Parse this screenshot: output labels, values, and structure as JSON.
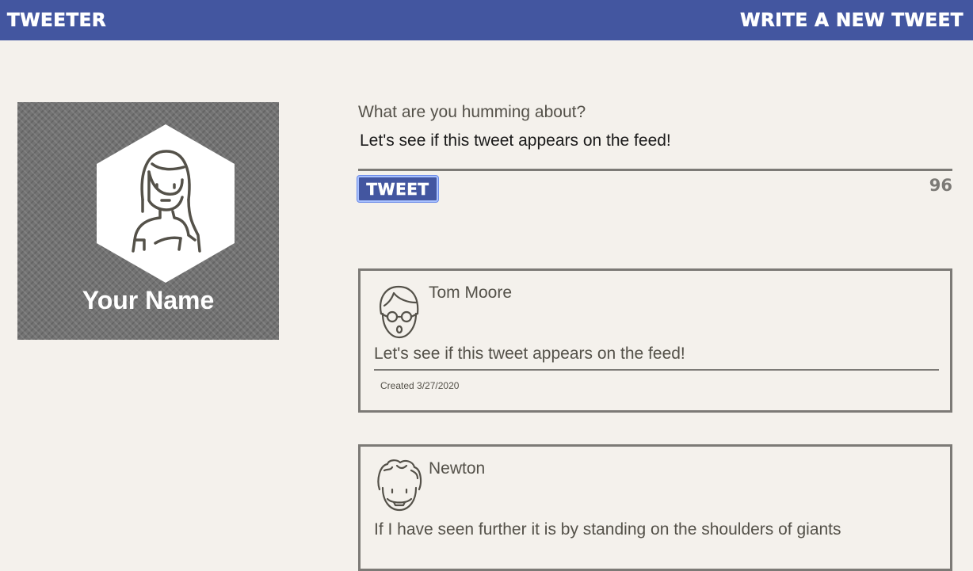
{
  "nav": {
    "brand": "TWEETER",
    "write_link": "WRITE A NEW TWEET"
  },
  "profile": {
    "name": "Your Name"
  },
  "compose": {
    "label": "What are you humming about?",
    "value": "Let's see if this tweet appears on the feed!",
    "button_label": "TWEET",
    "counter": "96"
  },
  "tweets": [
    {
      "author": "Tom Moore",
      "text": "Let's see if this tweet appears on the feed!",
      "created": "Created 3/27/2020"
    },
    {
      "author": "Newton",
      "text": "If I have seen further it is by standing on the shoulders of giants"
    }
  ],
  "colors": {
    "nav_bg": "#4356a0",
    "page_bg": "#f4f1ec",
    "text": "#545149",
    "border": "#7c7a76"
  }
}
